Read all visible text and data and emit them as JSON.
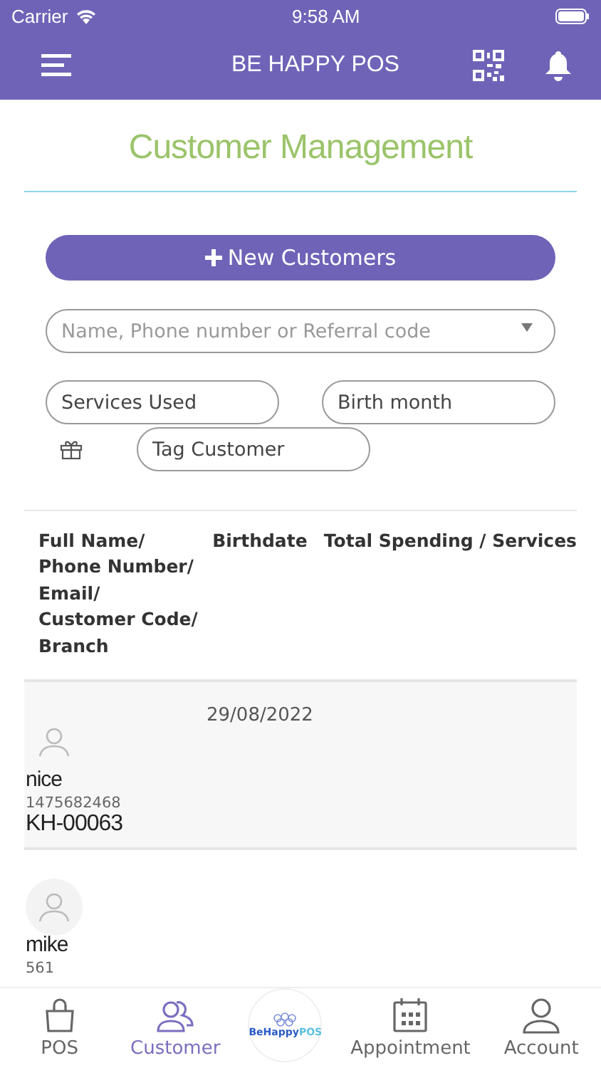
{
  "status_bar": {
    "carrier": "Carrier",
    "time": "9:58 AM"
  },
  "header": {
    "title": "BE HAPPY POS"
  },
  "page_title": "Customer Management",
  "new_button": {
    "label": "New Customers"
  },
  "search": {
    "placeholder": "Name, Phone number or Referral code"
  },
  "filters": [
    {
      "placeholder": "Services Used"
    },
    {
      "placeholder": "Birth month"
    },
    {
      "placeholder": "Tag Customer"
    }
  ],
  "table": {
    "columns": [
      "Full Name/ Phone Number/ Email/ Customer Code/ Branch",
      "Birthdate",
      "Total Spending / Services"
    ],
    "rows": [
      {
        "name": "nice",
        "phone": "1475682468",
        "code": "KH-00063",
        "birthdate": "29/08/2022"
      },
      {
        "name": "mike",
        "phone": "561"
      }
    ]
  },
  "tab_bar": [
    {
      "kind": "tab",
      "label": "POS",
      "selected": false
    },
    {
      "kind": "tab",
      "label": "Customer",
      "selected": true
    },
    {
      "kind": "logo",
      "label": "BeHappy",
      "suffix": "POS"
    },
    {
      "kind": "tab",
      "label": "Appointment",
      "selected": false
    },
    {
      "kind": "tab",
      "label": "Account",
      "selected": false
    }
  ]
}
